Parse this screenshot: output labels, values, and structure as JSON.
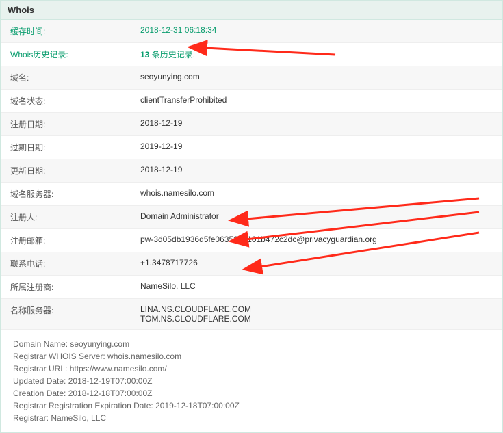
{
  "panel": {
    "title": "Whois"
  },
  "rows": [
    {
      "label": "缓存时间:",
      "labelClass": "green",
      "value": "2018-12-31 06:18:34",
      "valueClass": "green",
      "name": "cache-time"
    },
    {
      "label": "Whois历史记录:",
      "labelClass": "green",
      "value_html": true,
      "count": "13",
      "rest": " 条历史记录.",
      "name": "whois-history"
    },
    {
      "label": "域名:",
      "value": "seoyunying.com",
      "name": "domain-name"
    },
    {
      "label": "域名状态:",
      "value": "clientTransferProhibited",
      "name": "domain-status"
    },
    {
      "label": "注册日期:",
      "value": "2018-12-19",
      "name": "reg-date"
    },
    {
      "label": "过期日期:",
      "value": "2019-12-19",
      "name": "exp-date"
    },
    {
      "label": "更新日期:",
      "value": "2018-12-19",
      "name": "upd-date"
    },
    {
      "label": "域名服务器:",
      "value": "whois.namesilo.com",
      "name": "whois-server"
    },
    {
      "label": "注册人:",
      "value": "Domain Administrator",
      "name": "registrant"
    },
    {
      "label": "注册邮箱:",
      "value": "pw-3d05db1936d5fe0635213101b472c2dc@privacyguardian.org",
      "name": "reg-email"
    },
    {
      "label": "联系电话:",
      "value": "+1.3478717726",
      "name": "phone"
    },
    {
      "label": "所属注册商:",
      "value": "NameSilo, LLC",
      "name": "registrar"
    },
    {
      "label": "名称服务器:",
      "value": "LINA.NS.CLOUDFLARE.COM\nTOM.NS.CLOUDFLARE.COM",
      "name": "nameservers"
    }
  ],
  "raw": "Domain Name: seoyunying.com\nRegistrar WHOIS Server: whois.namesilo.com\nRegistrar URL: https://www.namesilo.com/\nUpdated Date: 2018-12-19T07:00:00Z\nCreation Date: 2018-12-18T07:00:00Z\nRegistrar Registration Expiration Date: 2019-12-18T07:00:00Z\nRegistrar: NameSilo, LLC"
}
